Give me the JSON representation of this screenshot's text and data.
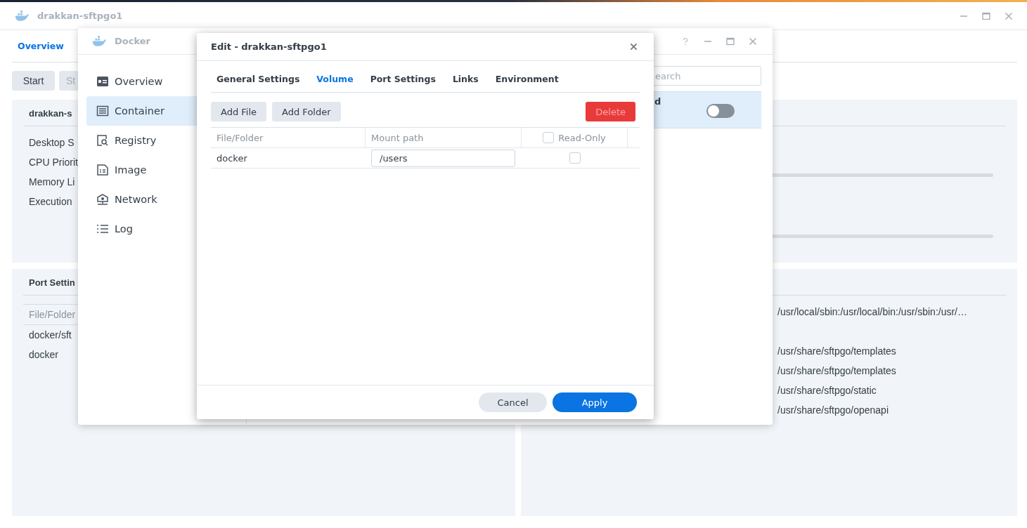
{
  "main_window": {
    "title": "drakkan-sftpgo1",
    "tabs": [
      {
        "label": "Overview",
        "selected": true
      }
    ],
    "buttons": [
      "Start",
      "St"
    ],
    "summary_panel": {
      "title": "drakkan-s",
      "rows": [
        "Desktop S",
        "CPU Priorit",
        "Memory Li",
        "Execution"
      ]
    },
    "volume_panel": {
      "title": "Port Settin",
      "column": "File/Folder",
      "rows": [
        "docker/sft",
        "docker"
      ]
    },
    "environment_panel": {
      "values": [
        "/usr/local/sbin:/usr/local/bin:/usr/sbin:/usr/…",
        "/usr/share/sftpgo/templates",
        "/usr/share/sftpgo/templates",
        "/usr/share/sftpgo/static",
        "/usr/share/sftpgo/openapi"
      ]
    }
  },
  "docker_window": {
    "title": "Docker",
    "sidebar": [
      {
        "label": "Overview",
        "selected": false
      },
      {
        "label": "Container",
        "selected": true
      },
      {
        "label": "Registry",
        "selected": false
      },
      {
        "label": "Image",
        "selected": false
      },
      {
        "label": "Network",
        "selected": false
      },
      {
        "label": "Log",
        "selected": false
      }
    ],
    "search": {
      "placeholder": "earch"
    },
    "list_item": {
      "label": "d",
      "selected": true,
      "on": false
    }
  },
  "edit_dialog": {
    "title": "Edit - drakkan-sftpgo1",
    "tabs": [
      {
        "label": "General Settings",
        "selected": false
      },
      {
        "label": "Volume",
        "selected": true
      },
      {
        "label": "Port Settings",
        "selected": false
      },
      {
        "label": "Links",
        "selected": false
      },
      {
        "label": "Environment",
        "selected": false
      }
    ],
    "toolbar": [
      {
        "label": "Add File",
        "kind": "plain",
        "disabled": false
      },
      {
        "label": "Add Folder",
        "kind": "plain",
        "disabled": false
      },
      {
        "label": "Delete",
        "kind": "danger",
        "disabled": true
      }
    ],
    "columns": {
      "file": "File/Folder",
      "mount": "Mount path",
      "read_only": "Read-Only",
      "read_only_all": false
    },
    "rows": [
      {
        "file": "docker",
        "mount_path": "/users",
        "read_only": false
      }
    ],
    "footer": [
      {
        "label": "Cancel",
        "kind": "secondary"
      },
      {
        "label": "Apply",
        "kind": "primary"
      }
    ]
  }
}
